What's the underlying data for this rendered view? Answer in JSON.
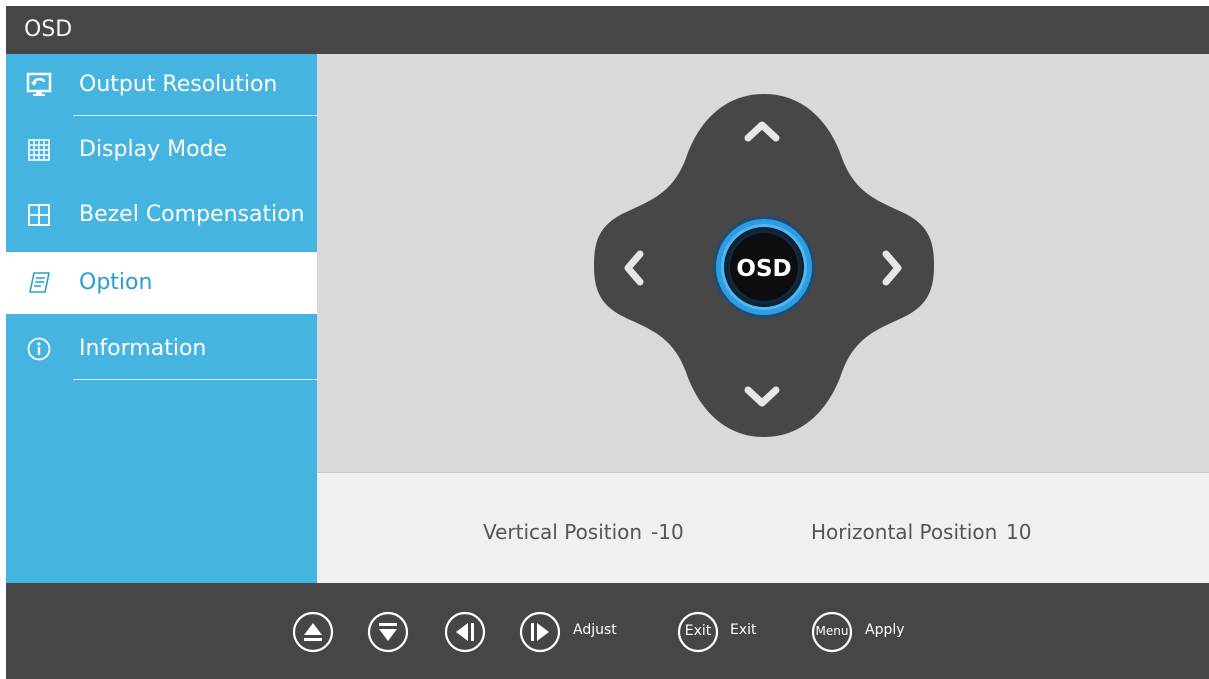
{
  "title": "OSD",
  "sidebar": {
    "items": [
      {
        "label": "Output Resolution",
        "icon": "output-resolution-icon"
      },
      {
        "label": "Display Mode",
        "icon": "grid-icon"
      },
      {
        "label": "Bezel Compensation",
        "icon": "quad-grid-icon"
      },
      {
        "label": "Option",
        "icon": "document-icon",
        "active": true
      },
      {
        "label": "Information",
        "icon": "info-icon"
      }
    ]
  },
  "dpad": {
    "center_label": "OSD"
  },
  "position": {
    "vertical_label": "Vertical Position",
    "vertical_value": "-10",
    "horizontal_label": "Horizontal Position",
    "horizontal_value": "10"
  },
  "footer": {
    "adjust_label": "Adjust",
    "exit_key": "Exit",
    "exit_label": "Exit",
    "menu_key": "Menu",
    "apply_label": "Apply"
  },
  "colors": {
    "sidebar": "#45b4e0",
    "titlebar": "#464646",
    "content": "#d9d9d9",
    "accent_ring": "#2e9ce0"
  }
}
